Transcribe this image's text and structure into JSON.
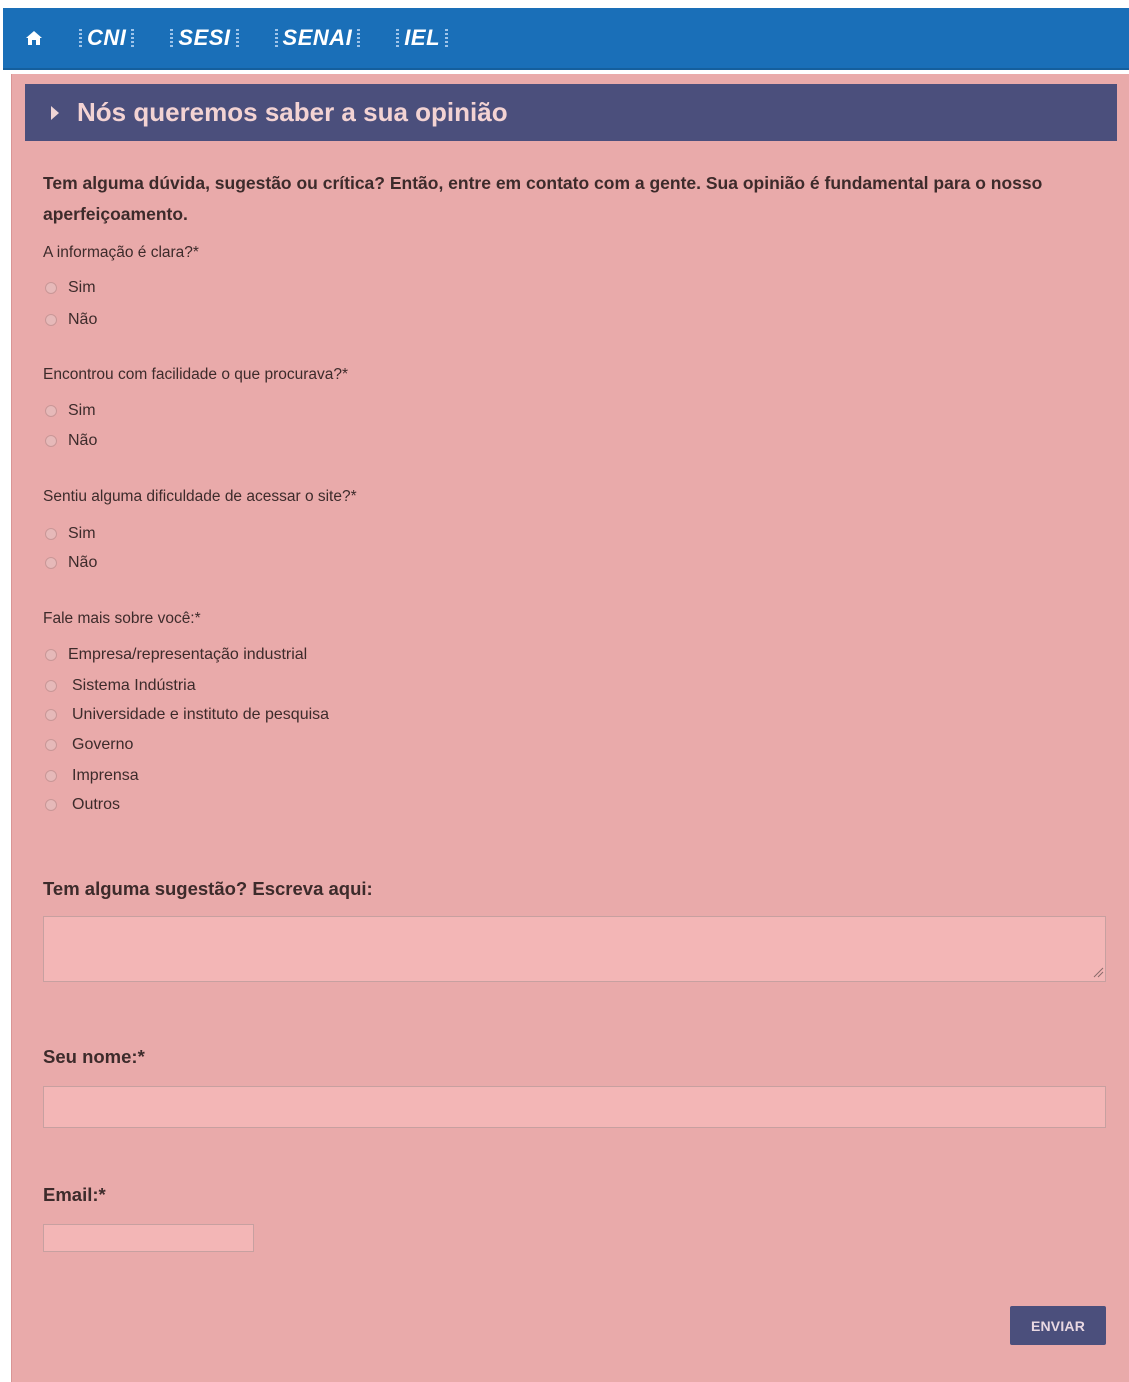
{
  "nav": {
    "home_icon": "home-icon",
    "links": [
      "CNI",
      "SESI",
      "SENAI",
      "IEL"
    ]
  },
  "panel": {
    "title": "Nós queremos saber a sua opinião",
    "intro": "Tem alguma dúvida, sugestão ou crítica? Então, entre em contato com a gente. Sua opinião é fundamental para o nosso aperfeiçoamento."
  },
  "questions": [
    {
      "label": "A informação é clara?*",
      "options": [
        "Sim",
        "Não"
      ]
    },
    {
      "label": "Encontrou com facilidade o que procurava?*",
      "options": [
        "Sim",
        "Não"
      ]
    },
    {
      "label": "Sentiu alguma dificuldade de acessar o site?*",
      "options": [
        "Sim",
        "Não"
      ]
    },
    {
      "label": "Fale mais sobre você:*",
      "options": [
        "Empresa/representação industrial",
        "Sistema Indústria",
        "Universidade e instituto de pesquisa",
        "Governo",
        "Imprensa",
        "Outros"
      ]
    }
  ],
  "suggestion": {
    "label": "Tem alguma sugestão? Escreva aqui:",
    "value": ""
  },
  "name_field": {
    "label": "Seu nome:*",
    "value": ""
  },
  "email_field": {
    "label": "Email:*",
    "value": ""
  },
  "submit_label": "ENVIAR",
  "colors": {
    "nav_bg": "#1a6fb8",
    "panel_bg": "#e9aaaa",
    "header_bg": "#4b4f7c",
    "input_bg": "#f3b6b6"
  }
}
